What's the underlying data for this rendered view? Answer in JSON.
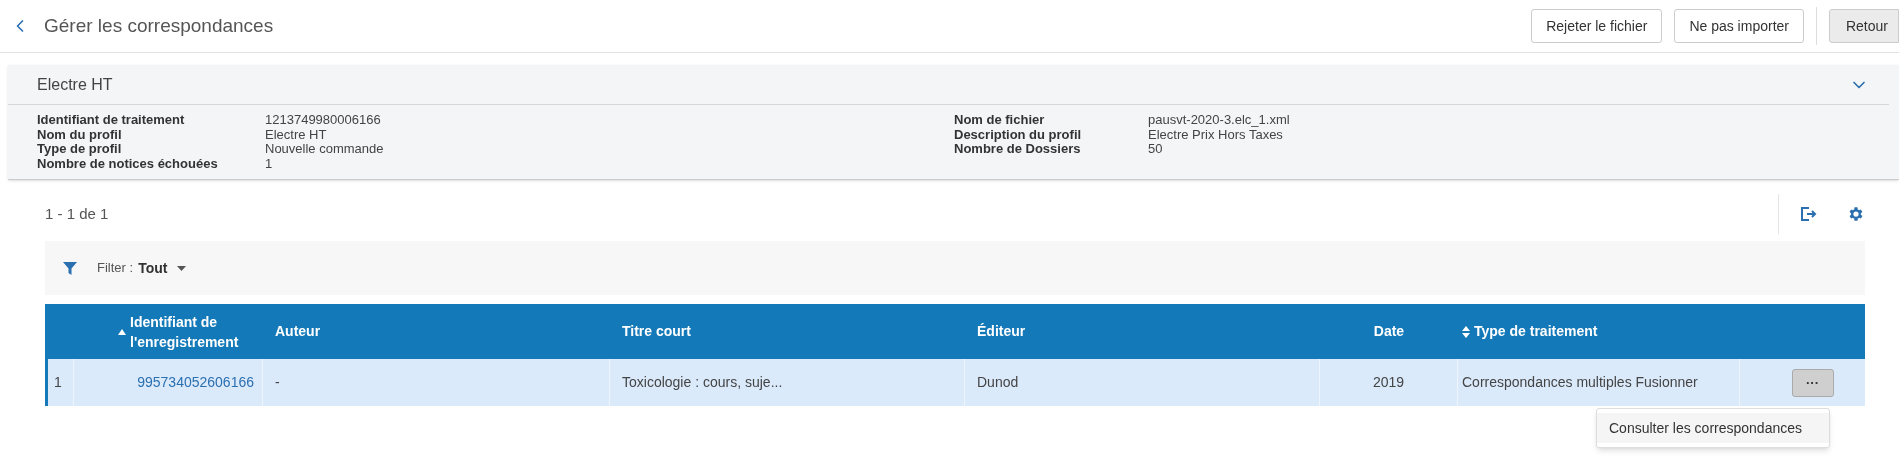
{
  "header": {
    "title": "Gérer les correspondances",
    "buttons": [
      {
        "label": "Rejeter le fichier",
        "kind": "outline"
      },
      {
        "label": "Ne pas importer",
        "kind": "outline"
      },
      {
        "label": "Retour",
        "kind": "filled"
      }
    ]
  },
  "profile_card": {
    "title": "Electre HT",
    "expanded": true,
    "left_fields": [
      {
        "label": "Identifiant de traitement",
        "value": "1213749980006166"
      },
      {
        "label": "Nom du profil",
        "value": "Electre HT"
      },
      {
        "label": "Type de profil",
        "value": "Nouvelle commande"
      },
      {
        "label": "Nombre de notices échouées",
        "value": "1"
      }
    ],
    "right_fields": [
      {
        "label": "Nom de fichier",
        "value": "pausvt-2020-3.elc_1.xml"
      },
      {
        "label": "Description du profil",
        "value": "Electre Prix Hors Taxes"
      },
      {
        "label": "Nombre de Dossiers",
        "value": "50"
      }
    ]
  },
  "results": {
    "count": "1 - 1 de 1"
  },
  "filter": {
    "label": "Filter :",
    "value": "Tout"
  },
  "table": {
    "columns": [
      {
        "label": "Identifiant de l'enregistrement",
        "sorted_ascending": true,
        "sortable": false
      },
      {
        "label": "Auteur",
        "sorted_ascending": false,
        "sortable": false
      },
      {
        "label": "Titre court",
        "sorted_ascending": false,
        "sortable": false
      },
      {
        "label": "Éditeur",
        "sorted_ascending": false,
        "sortable": false
      },
      {
        "label": "Date",
        "sorted_ascending": false,
        "sortable": false
      },
      {
        "label": "Type de traitement",
        "sorted_ascending": false,
        "sortable": true
      }
    ],
    "rows": [
      {
        "number": "1",
        "selected": true,
        "cells": [
          "995734052606166",
          "-",
          "Toxicologie : cours, suje...",
          "Dunod",
          "2019",
          "Correspondances multiples Fusionner"
        ],
        "actions_button": "···"
      }
    ]
  },
  "row_menu": {
    "items": [
      "Consulter les correspondances"
    ]
  }
}
